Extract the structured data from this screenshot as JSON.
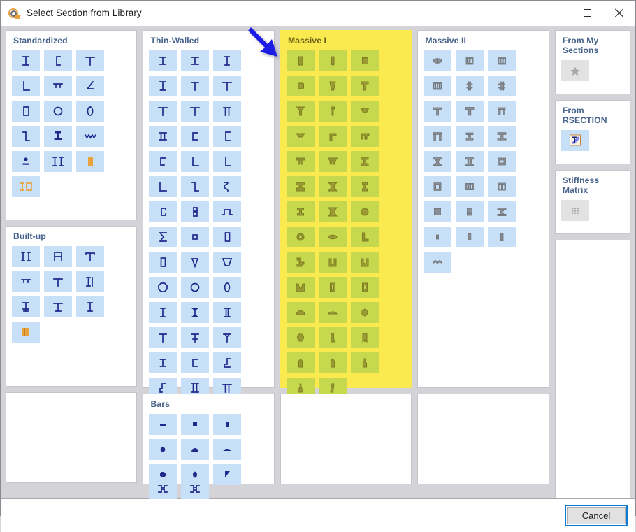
{
  "window": {
    "title": "Select Section from Library",
    "icon": "section-library-icon",
    "minimize_label": "Minimize",
    "maximize_label": "Maximize",
    "close_label": "Close"
  },
  "footer": {
    "cancel_label": "Cancel"
  },
  "annotation": {
    "arrow": "blue-arrow-pointing-to-massive-i"
  },
  "colors": {
    "highlight_panel_bg": "#faea4f",
    "highlight_tile_bg": "#c6d84d",
    "highlight_icon": "#9a9a33",
    "tile_bg": "#c8e0f7",
    "icon": "#1f2a8c",
    "icon_orange": "#e8a33d",
    "icon_gray": "#8d9196",
    "panel_title": "#46618a",
    "window_bg": "#d3d3d8",
    "focus_ring": "#0c7cd5"
  },
  "panels": {
    "standardized": {
      "title": "Standardized",
      "highlighted": false,
      "items": [
        {
          "name": "i-section",
          "style": "blue"
        },
        {
          "name": "channel-section",
          "style": "blue"
        },
        {
          "name": "tee-section",
          "style": "blue"
        },
        {
          "name": "angle-section",
          "style": "blue"
        },
        {
          "name": "rail-section",
          "style": "blue"
        },
        {
          "name": "unequal-angle-section",
          "style": "blue"
        },
        {
          "name": "rectangular-hollow-section",
          "style": "blue"
        },
        {
          "name": "circular-hollow-section",
          "style": "blue"
        },
        {
          "name": "oval-hollow-section",
          "style": "blue"
        },
        {
          "name": "z-section",
          "style": "blue"
        },
        {
          "name": "crane-rail-section",
          "style": "blue"
        },
        {
          "name": "wave-section",
          "style": "blue"
        },
        {
          "name": "pin-section",
          "style": "blue"
        },
        {
          "name": "double-i-section",
          "style": "blue"
        },
        {
          "name": "solid-rectangle-orange",
          "style": "orange"
        },
        {
          "name": "i-plus-hollow-orange",
          "style": "orange"
        }
      ]
    },
    "built_up": {
      "title": "Built-up",
      "highlighted": false,
      "items": [
        {
          "name": "double-channel-section",
          "style": "blue"
        },
        {
          "name": "double-i-back-to-back",
          "style": "blue"
        },
        {
          "name": "tee-built-up-section",
          "style": "blue"
        },
        {
          "name": "tee-flange-section",
          "style": "blue"
        },
        {
          "name": "tee-stem-section",
          "style": "blue"
        },
        {
          "name": "i-with-plate-section",
          "style": "blue"
        },
        {
          "name": "i-with-bottom-plate",
          "style": "blue"
        },
        {
          "name": "i-with-top-plate",
          "style": "blue"
        },
        {
          "name": "i-narrow-section",
          "style": "blue"
        },
        {
          "name": "multi-web-orange",
          "style": "orange"
        }
      ]
    },
    "thin_walled": {
      "title": "Thin-Walled",
      "highlighted": false,
      "items": [
        {
          "name": "i-symmetric",
          "style": "blue"
        },
        {
          "name": "i-wide-flange",
          "style": "blue"
        },
        {
          "name": "i-narrow-flange",
          "style": "blue"
        },
        {
          "name": "i-tapered",
          "style": "blue"
        },
        {
          "name": "tee-plain",
          "style": "blue"
        },
        {
          "name": "tee-wide",
          "style": "blue"
        },
        {
          "name": "tee-thick-web",
          "style": "blue"
        },
        {
          "name": "tee-thin",
          "style": "blue"
        },
        {
          "name": "double-tee-open",
          "style": "blue"
        },
        {
          "name": "double-i-joined",
          "style": "blue"
        },
        {
          "name": "channel-square",
          "style": "blue"
        },
        {
          "name": "channel-bracket",
          "style": "blue"
        },
        {
          "name": "channel-lipped",
          "style": "blue"
        },
        {
          "name": "angle-l",
          "style": "blue"
        },
        {
          "name": "angle-l-thin",
          "style": "blue"
        },
        {
          "name": "angle-l-wide",
          "style": "blue"
        },
        {
          "name": "z-profile",
          "style": "blue"
        },
        {
          "name": "sigma-curved",
          "style": "blue"
        },
        {
          "name": "c-profile",
          "style": "blue"
        },
        {
          "name": "b-profile",
          "style": "blue"
        },
        {
          "name": "hat-profile",
          "style": "blue"
        },
        {
          "name": "sigma-profile",
          "style": "blue"
        },
        {
          "name": "square-hollow",
          "style": "blue"
        },
        {
          "name": "rectangular-hollow",
          "style": "blue"
        },
        {
          "name": "rectangular-hollow-thick",
          "style": "blue"
        },
        {
          "name": "trapezoid-open",
          "style": "blue"
        },
        {
          "name": "trapezoid-wide",
          "style": "blue"
        },
        {
          "name": "octagon-hollow",
          "style": "blue"
        },
        {
          "name": "circular-hollow",
          "style": "blue"
        },
        {
          "name": "oval-hollow",
          "style": "blue"
        },
        {
          "name": "i-slim",
          "style": "blue"
        },
        {
          "name": "i-slim-tapered",
          "style": "blue"
        },
        {
          "name": "box-double-web",
          "style": "blue"
        },
        {
          "name": "tee-upright",
          "style": "blue"
        },
        {
          "name": "i-short-flange",
          "style": "blue"
        },
        {
          "name": "i-curved-flange",
          "style": "blue"
        },
        {
          "name": "i-plain",
          "style": "blue"
        },
        {
          "name": "channel-open-top",
          "style": "blue"
        },
        {
          "name": "zed-open",
          "style": "blue"
        },
        {
          "name": "zed-lipped",
          "style": "blue"
        },
        {
          "name": "double-channel-open",
          "style": "blue"
        },
        {
          "name": "double-tee-web",
          "style": "blue"
        },
        {
          "name": "double-i-stacked",
          "style": "blue"
        },
        {
          "name": "double-tee-stacked",
          "style": "blue"
        },
        {
          "name": "pentagon-hollow",
          "style": "blue"
        },
        {
          "name": "house-hollow",
          "style": "blue"
        },
        {
          "name": "cross-section",
          "style": "blue"
        },
        {
          "name": "tee-inverted-thin",
          "style": "blue"
        },
        {
          "name": "tee-thick-stem",
          "style": "blue"
        },
        {
          "name": "tee-flat-wide",
          "style": "blue"
        },
        {
          "name": "i-bold",
          "style": "blue"
        },
        {
          "name": "double-c-joined",
          "style": "blue"
        },
        {
          "name": "double-c-mirrored",
          "style": "blue"
        }
      ]
    },
    "massive_i": {
      "title": "Massive I",
      "highlighted": true,
      "items": [
        {
          "name": "solid-rectangle-tall",
          "style": "olive"
        },
        {
          "name": "solid-rectangle-narrow",
          "style": "olive"
        },
        {
          "name": "solid-square",
          "style": "olive"
        },
        {
          "name": "solid-square-rounded",
          "style": "olive"
        },
        {
          "name": "solid-trapezoid-down",
          "style": "olive"
        },
        {
          "name": "solid-tee",
          "style": "olive"
        },
        {
          "name": "solid-tee-tapered",
          "style": "olive"
        },
        {
          "name": "solid-tee-narrow",
          "style": "olive"
        },
        {
          "name": "solid-trapezoid-flat",
          "style": "olive"
        },
        {
          "name": "solid-tee-flange-taper",
          "style": "olive"
        },
        {
          "name": "solid-angle-tee",
          "style": "olive"
        },
        {
          "name": "solid-double-leg",
          "style": "olive"
        },
        {
          "name": "solid-double-leg-wide",
          "style": "olive"
        },
        {
          "name": "solid-double-leg-taper",
          "style": "olive"
        },
        {
          "name": "solid-i-beam",
          "style": "olive"
        },
        {
          "name": "solid-i-beam-wide",
          "style": "olive"
        },
        {
          "name": "solid-i-tapered",
          "style": "olive"
        },
        {
          "name": "solid-i-narrow",
          "style": "olive"
        },
        {
          "name": "solid-i-short",
          "style": "olive"
        },
        {
          "name": "solid-i-flared",
          "style": "olive"
        },
        {
          "name": "solid-circle",
          "style": "olive"
        },
        {
          "name": "solid-ring",
          "style": "olive"
        },
        {
          "name": "solid-ellipse",
          "style": "olive"
        },
        {
          "name": "solid-angle",
          "style": "olive"
        },
        {
          "name": "solid-z-shape",
          "style": "olive"
        },
        {
          "name": "solid-u-shape",
          "style": "olive"
        },
        {
          "name": "solid-u-rounded",
          "style": "olive"
        },
        {
          "name": "solid-u-wide",
          "style": "olive"
        },
        {
          "name": "solid-rect-hollow",
          "style": "olive"
        },
        {
          "name": "solid-rect-oval-hollow",
          "style": "olive"
        },
        {
          "name": "solid-dome",
          "style": "olive"
        },
        {
          "name": "solid-dome-flat",
          "style": "olive"
        },
        {
          "name": "solid-hexagon",
          "style": "olive"
        },
        {
          "name": "solid-octagon",
          "style": "olive"
        },
        {
          "name": "solid-wedge",
          "style": "olive"
        },
        {
          "name": "solid-notched-block",
          "style": "olive"
        },
        {
          "name": "solid-rounded-top-block",
          "style": "olive"
        },
        {
          "name": "solid-pointed-block",
          "style": "olive"
        },
        {
          "name": "solid-bottle-shape",
          "style": "olive"
        },
        {
          "name": "solid-bottle-narrow",
          "style": "olive"
        },
        {
          "name": "solid-parallelogram",
          "style": "olive"
        }
      ]
    },
    "massive_ii": {
      "title": "Massive II",
      "highlighted": false,
      "items": [
        {
          "name": "barrel-hollow-gray",
          "style": "gray"
        },
        {
          "name": "double-cell-box-gray",
          "style": "gray"
        },
        {
          "name": "triple-cell-box-gray",
          "style": "gray"
        },
        {
          "name": "quad-cell-box-gray",
          "style": "gray"
        },
        {
          "name": "single-web-cross-gray",
          "style": "gray"
        },
        {
          "name": "double-web-cross-gray",
          "style": "gray"
        },
        {
          "name": "tee-massive-gray",
          "style": "gray"
        },
        {
          "name": "tee-massive-wide-gray",
          "style": "gray"
        },
        {
          "name": "portal-frame-gray",
          "style": "gray"
        },
        {
          "name": "portal-frame-wide-gray",
          "style": "gray"
        },
        {
          "name": "i-massive-gray",
          "style": "gray"
        },
        {
          "name": "i-massive-wide-gray",
          "style": "gray"
        },
        {
          "name": "i-flared-gray",
          "style": "gray"
        },
        {
          "name": "i-double-web-gray",
          "style": "gray"
        },
        {
          "name": "box-with-cell-gray",
          "style": "gray"
        },
        {
          "name": "box-vertical-cell-gray",
          "style": "gray"
        },
        {
          "name": "box-triple-vertical-gray",
          "style": "gray"
        },
        {
          "name": "box-double-vertical-gray",
          "style": "gray"
        },
        {
          "name": "four-cell-grid-gray",
          "style": "gray"
        },
        {
          "name": "six-cell-grid-gray",
          "style": "gray"
        },
        {
          "name": "i-wide-flared-gray",
          "style": "gray"
        },
        {
          "name": "small-stack-gray",
          "style": "gray"
        },
        {
          "name": "triple-stack-gray",
          "style": "gray"
        },
        {
          "name": "multi-stack-gray",
          "style": "gray"
        },
        {
          "name": "curved-deck-gray",
          "style": "gray"
        }
      ]
    },
    "bars": {
      "title": "Bars",
      "highlighted": false,
      "items": [
        {
          "name": "flat-bar",
          "style": "blue"
        },
        {
          "name": "square-bar",
          "style": "blue"
        },
        {
          "name": "rectangular-bar",
          "style": "blue"
        },
        {
          "name": "round-bar",
          "style": "blue"
        },
        {
          "name": "half-round-bar",
          "style": "blue"
        },
        {
          "name": "shallow-segment-bar",
          "style": "blue"
        },
        {
          "name": "octagon-bar",
          "style": "blue"
        },
        {
          "name": "oval-bar",
          "style": "blue"
        },
        {
          "name": "triangular-bar",
          "style": "blue"
        }
      ]
    },
    "from_my_sections": {
      "title": "From My Sections",
      "highlighted": false,
      "items": [
        {
          "name": "star-icon",
          "style": "disabled"
        }
      ]
    },
    "from_rsection": {
      "title": "From RSECTION",
      "highlighted": false,
      "items": [
        {
          "name": "rsection-icon",
          "style": "rsection"
        }
      ]
    },
    "stiffness_matrix": {
      "title": "Stiffness Matrix",
      "highlighted": false,
      "items": [
        {
          "name": "matrix-grid-icon",
          "style": "disabled"
        }
      ]
    },
    "empty_bottom_left": {
      "title": "",
      "highlighted": false,
      "items": []
    },
    "empty_bottom_massive_i": {
      "title": "",
      "highlighted": false,
      "items": []
    },
    "empty_bottom_massive_ii": {
      "title": "",
      "highlighted": false,
      "items": []
    },
    "empty_right": {
      "title": "",
      "highlighted": false,
      "items": []
    }
  }
}
